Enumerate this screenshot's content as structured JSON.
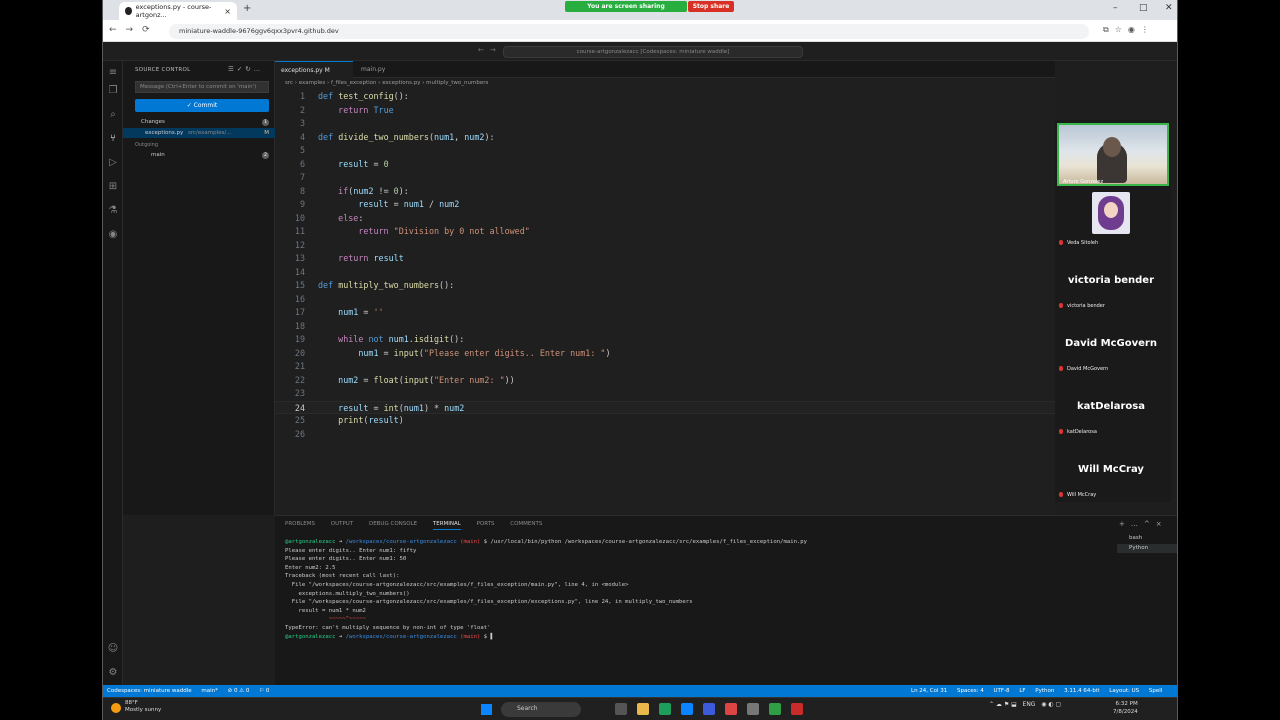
{
  "browser": {
    "tab_title": "exceptions.py - course-artgonz...",
    "new_tab": "+",
    "url": "miniature-waddle-9676ggv6qxx3pvr4.github.dev",
    "share_banner": "You are screen sharing",
    "stop_share": "Stop share",
    "win_controls": [
      "–",
      "□",
      "✕"
    ]
  },
  "vscode": {
    "command_center": "course-artgonzalezacc [Codespaces: miniature waddle]",
    "sidebar": {
      "title": "SOURCE CONTROL",
      "commit_placeholder": "Message (Ctrl+Enter to commit on 'main')",
      "commit_button": "✓ Commit",
      "changes_label": "Changes",
      "changes_count": "1",
      "file_name": "exceptions.py",
      "file_path": "src/examples/...",
      "file_status": "M",
      "outgoing_label": "Outgoing",
      "branch": "main",
      "branch_count": "2"
    },
    "editor_tabs": [
      {
        "label": "exceptions.py  M",
        "active": true
      },
      {
        "label": "main.py",
        "active": false
      }
    ],
    "breadcrumbs": "src › examples › f_files_exception › exceptions.py › multiply_two_numbers",
    "code_lines": [
      {
        "n": "1",
        "html": "<span class='kw'>def</span> <span class='fn'>test_config</span>():"
      },
      {
        "n": "2",
        "html": "    <span class='kw2'>return</span> <span class='kw'>True</span>"
      },
      {
        "n": "3",
        "html": ""
      },
      {
        "n": "4",
        "html": "<span class='kw'>def</span> <span class='fn'>divide_two_numbers</span>(<span class='vr'>num1</span>, <span class='vr'>num2</span>):"
      },
      {
        "n": "5",
        "html": ""
      },
      {
        "n": "6",
        "html": "    <span class='vr'>result</span> = <span class='nm'>0</span>"
      },
      {
        "n": "7",
        "html": ""
      },
      {
        "n": "8",
        "html": "    <span class='kw2'>if</span>(<span class='vr'>num2</span> != <span class='nm'>0</span>):"
      },
      {
        "n": "9",
        "html": "        <span class='vr'>result</span> = <span class='vr'>num1</span> / <span class='vr'>num2</span>"
      },
      {
        "n": "10",
        "html": "    <span class='kw2'>else</span>:"
      },
      {
        "n": "11",
        "html": "        <span class='kw2'>return</span> <span class='st'>\"Division by 0 not allowed\"</span>"
      },
      {
        "n": "12",
        "html": ""
      },
      {
        "n": "13",
        "html": "    <span class='kw2'>return</span> <span class='vr'>result</span>"
      },
      {
        "n": "14",
        "html": ""
      },
      {
        "n": "15",
        "html": "<span class='kw'>def</span> <span class='fn'>multiply_two_numbers</span>():"
      },
      {
        "n": "16",
        "html": ""
      },
      {
        "n": "17",
        "html": "    <span class='vr'>num1</span> = <span class='st'>''</span>"
      },
      {
        "n": "18",
        "html": ""
      },
      {
        "n": "19",
        "html": "    <span class='kw2'>while</span> <span class='kw'>not</span> <span class='vr'>num1</span>.<span class='fn'>isdigit</span>():"
      },
      {
        "n": "20",
        "html": "        <span class='vr'>num1</span> = <span class='fn'>input</span>(<span class='st'>\"Please enter digits.. Enter num1: \"</span>)"
      },
      {
        "n": "21",
        "html": ""
      },
      {
        "n": "22",
        "html": "    <span class='vr'>num2</span> = <span class='fn'>float</span>(<span class='fn'>input</span>(<span class='st'>\"Enter num2: \"</span>))"
      },
      {
        "n": "23",
        "html": ""
      },
      {
        "n": "24",
        "html": "    <span class='vr'>result</span> = <span class='fn'>int</span>(<span class='vr'>num1</span>) * <span class='vr'>num2</span>"
      },
      {
        "n": "25",
        "html": "    <span class='fn'>print</span>(<span class='vr'>result</span>)"
      },
      {
        "n": "26",
        "html": ""
      }
    ],
    "panel_tabs": [
      "PROBLEMS",
      "OUTPUT",
      "DEBUG CONSOLE",
      "TERMINAL",
      "PORTS",
      "COMMENTS"
    ],
    "terminal_lines": [
      "<span class='tg'>@artgonzalezacc</span> ➜ <span class='tb'>/workspaces/course-artgonzalezacc</span> <span class='tr'>(main)</span> $ /usr/local/bin/python /workspaces/course-artgonzalezacc/src/examples/f_files_exception/main.py",
      "Please enter digits.. Enter num1: fifty",
      "Please enter digits.. Enter num1: 50",
      "Enter num2: 2.5",
      "Traceback (most recent call last):",
      "  File \"/workspaces/course-artgonzalezacc/src/examples/f_files_exception/main.py\", line 4, in &lt;module&gt;",
      "    exceptions.multiply_two_numbers()",
      "  File \"/workspaces/course-artgonzalezacc/src/examples/f_files_exception/exceptions.py\", line 24, in multiply_two_numbers",
      "    result = num1 * num2",
      "             <span class='tr'>~~~~~^~~~~~</span>",
      "TypeError: can't multiply sequence by non-int of type 'float'",
      "<span class='tg'>@artgonzalezacc</span> ➜ <span class='tb'>/workspaces/course-artgonzalezacc</span> <span class='tr'>(main)</span> $ ▌"
    ],
    "terminal_list": [
      "bash",
      "Python"
    ],
    "status_left": [
      "Codespaces: miniature waddle",
      "main*",
      "⊘ 0 ⚠ 0",
      "⚐ 0"
    ],
    "status_right": [
      "Ln 24, Col 31",
      "Spaces: 4",
      "UTF-8",
      "LF",
      "Python",
      "3.11.4 64-bit",
      "Layout: US",
      "Spell"
    ]
  },
  "meeting": {
    "main_name": "Arturo Gonzalez",
    "participants": [
      {
        "big": "",
        "small": "Veda Sitoleh"
      },
      {
        "big": "victoria bender",
        "small": "victoria bender"
      },
      {
        "big": "David McGovern",
        "small": "David McGovern"
      },
      {
        "big": "katDelarosa",
        "small": "katDelarosa"
      },
      {
        "big": "Will McCray",
        "small": "Will McCray"
      }
    ]
  },
  "taskbar": {
    "temp": "88°F",
    "weather": "Mostly sunny",
    "search": "Search",
    "lang": "ENG",
    "time": "6:32 PM",
    "date": "7/8/2024"
  }
}
